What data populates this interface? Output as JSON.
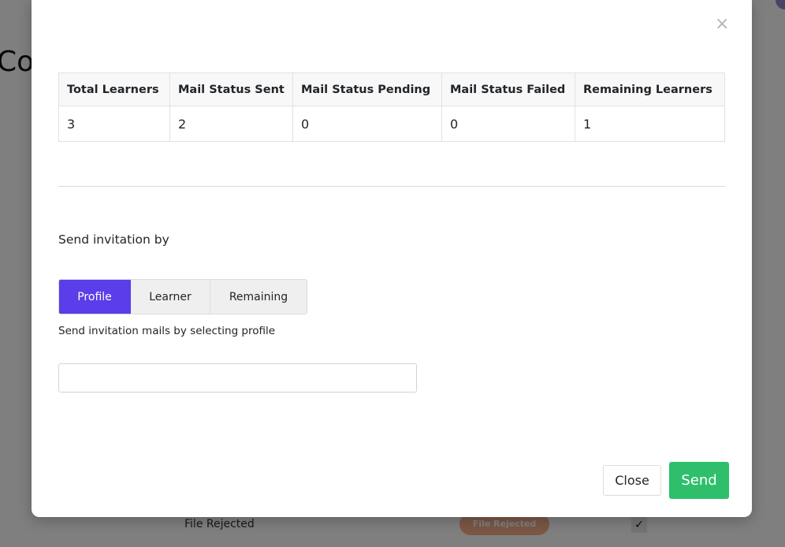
{
  "background": {
    "title_partial": "Co",
    "row_text": "File Rejected",
    "row_badge": "File Rejected",
    "row_check": "✓"
  },
  "modal": {
    "close_icon": "×",
    "stats_table": {
      "headers": [
        "Total Learners",
        "Mail Status Sent",
        "Mail Status Pending",
        "Mail Status Failed",
        "Remaining Learners"
      ],
      "values": [
        "3",
        "2",
        "0",
        "0",
        "1"
      ]
    },
    "send_label": "Send invitation by",
    "tabs": [
      {
        "label": "Profile",
        "active": true
      },
      {
        "label": "Learner",
        "active": false
      },
      {
        "label": "Remaining",
        "active": false
      }
    ],
    "help_text": "Send invitation mails by selecting profile",
    "profile_input": {
      "value": "",
      "placeholder": ""
    },
    "close_button": "Close",
    "send_button": "Send"
  },
  "colors": {
    "accent": "#5b3ee9",
    "success": "#2fbf6c",
    "badge": "#f6b08c"
  }
}
